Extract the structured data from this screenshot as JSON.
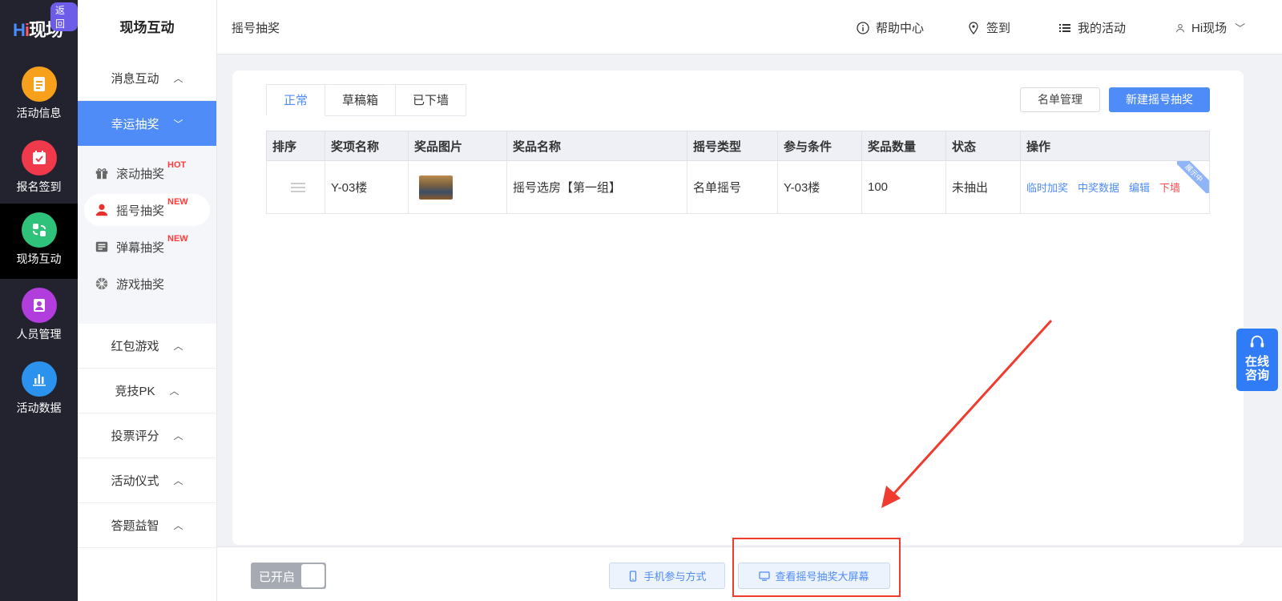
{
  "brand": {
    "logo_text": "Hi现场",
    "back_badge": "返回"
  },
  "rail": {
    "items": [
      {
        "label": "活动信息",
        "icon": "document-icon",
        "color": "#f7a01c"
      },
      {
        "label": "报名签到",
        "icon": "calendar-check-icon",
        "color": "#f0394a"
      },
      {
        "label": "现场互动",
        "icon": "interaction-icon",
        "color": "#2fc27a",
        "active": true
      },
      {
        "label": "人员管理",
        "icon": "person-badge-icon",
        "color": "#b03ddc"
      },
      {
        "label": "活动数据",
        "icon": "bar-chart-icon",
        "color": "#2b93ee"
      }
    ]
  },
  "sidebar": {
    "title": "现场互动",
    "groups_top": [
      {
        "label": "消息互动",
        "chevron": "^"
      },
      {
        "label": "幸运抽奖",
        "chevron": "v",
        "active": true
      }
    ],
    "sub_items": [
      {
        "label": "滚动抽奖",
        "tag": "HOT",
        "icon": "gift-icon"
      },
      {
        "label": "摇号抽奖",
        "tag": "NEW",
        "icon": "person-icon",
        "active": true
      },
      {
        "label": "弹幕抽奖",
        "tag": "NEW",
        "icon": "barrage-icon"
      },
      {
        "label": "游戏抽奖",
        "tag": "",
        "icon": "wheel-icon"
      }
    ],
    "groups_bottom": [
      {
        "label": "红包游戏",
        "chevron": "^"
      },
      {
        "label": "竞技PK",
        "chevron": "^"
      },
      {
        "label": "投票评分",
        "chevron": "^"
      },
      {
        "label": "活动仪式",
        "chevron": "^"
      },
      {
        "label": "答题益智",
        "chevron": "^"
      }
    ]
  },
  "header": {
    "breadcrumb": "摇号抽奖",
    "help": "帮助中心",
    "checkin": "签到",
    "my_activities": "我的活动",
    "user": "Hi现场"
  },
  "main": {
    "tabs": [
      "正常",
      "草稿箱",
      "已下墙"
    ],
    "list_button": "名单管理",
    "new_button": "新建摇号抽奖",
    "columns": [
      "排序",
      "奖项名称",
      "奖品图片",
      "奖品名称",
      "摇号类型",
      "参与条件",
      "奖品数量",
      "状态",
      "操作"
    ],
    "rows": [
      {
        "award": "Y-03楼",
        "prize_name": "摇号选房【第一组】",
        "type": "名单摇号",
        "condition": "Y-03楼",
        "quantity": "100",
        "status": "未抽出",
        "ops": [
          "临时加奖",
          "中奖数据",
          "编辑",
          "下墙"
        ],
        "ribbon": "展示中"
      }
    ]
  },
  "bottom": {
    "toggle_label": "已开启",
    "mobile_button": "手机参与方式",
    "screen_button": "查看摇号抽奖大屏幕"
  },
  "consult": {
    "line1": "在线",
    "line2": "咨询"
  },
  "colors": {
    "accent": "#4f8cf7",
    "annotation_red": "#f03c2e",
    "status_green": "#33b35a"
  }
}
